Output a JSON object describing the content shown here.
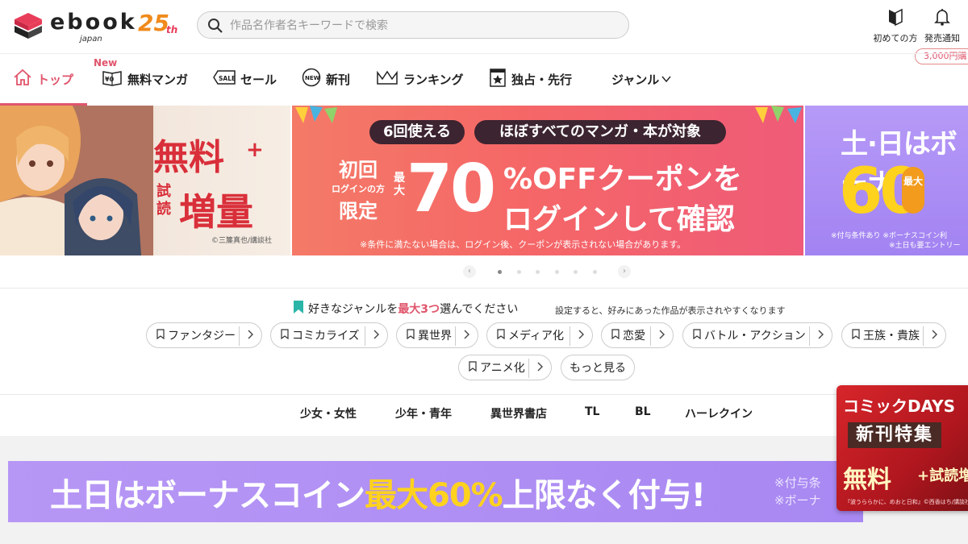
{
  "header": {
    "logo_text": "ebook",
    "logo_sub": "japan",
    "logo_anniv_num": "25",
    "logo_anniv_suffix": "th",
    "search_placeholder": "作品名作者名キーワードで検索",
    "first_time_label": "初めての方",
    "notice_label": "発売通知",
    "coin_pill": "3,000円購"
  },
  "nav": {
    "new_badge": "New",
    "items": [
      {
        "label": "トップ",
        "icon": "home-icon"
      },
      {
        "label": "無料マンガ",
        "icon": "free-book-icon"
      },
      {
        "label": "セール",
        "icon": "sale-tag-icon"
      },
      {
        "label": "新刊",
        "icon": "new-badge-icon"
      },
      {
        "label": "ランキング",
        "icon": "crown-icon"
      },
      {
        "label": "独占・先行",
        "icon": "exclusive-star-icon"
      },
      {
        "label": "ジャンル",
        "icon": "chevron-down-icon"
      }
    ],
    "active_color": "#e0556c"
  },
  "banners": {
    "b1": {
      "title_a": "無料",
      "plus": "+",
      "small": "試読",
      "title_b": "増量",
      "credit": "©三簾真也/講談社"
    },
    "b2": {
      "pill1": "6回使える",
      "pill2": "ほぼすべてのマンガ・本が対象",
      "lead_a": "初回",
      "lead_b": "ログインの方",
      "lead_c": "限定",
      "max": "最大",
      "big": "70",
      "line1": "%OFFクーポンを",
      "line2": "ログインして確認",
      "note": "※条件に満たない場合は、ログイン後、クーポンが表示されない場合があります。"
    },
    "b3": {
      "title": "土·日はボーナ",
      "big": "60",
      "max_badge": "最大",
      "note1": "※付与条件あり ※ボーナスコイン利",
      "note2": "※土日も要エントリー"
    }
  },
  "carousel": {
    "prev": "‹",
    "next": "›",
    "dot_count": 6,
    "active_index": 0
  },
  "genre": {
    "heading_pre": "好きなジャンルを",
    "heading_hl": "最大3つ",
    "heading_post": "選んでください",
    "sub": "設定すると、好みにあった作品が表示されやすくなります",
    "chips": [
      "ファンタジー",
      "コミカライズ",
      "異世界",
      "メディア化",
      "恋愛",
      "バトル・アクション",
      "王族・貴族",
      "アニメ化"
    ],
    "more": "もっと見る"
  },
  "categories": [
    "少女・女性",
    "少年・青年",
    "異世界書店",
    "TL",
    "BL",
    "ハーレクイン"
  ],
  "bonus_banner": {
    "text_a": "土日はボーナスコイン",
    "text_b": "最大60%",
    "text_c": "上限なく付与!",
    "note1": "※付与条",
    "note2": "※ボーナ"
  },
  "floating_ad": {
    "l1": "コミックDAYS",
    "l2": "新刊特集",
    "l3": "無料",
    "l3b": "+試読増",
    "note": "『波うららかに、めおと日和』©西香はち/講談社"
  }
}
